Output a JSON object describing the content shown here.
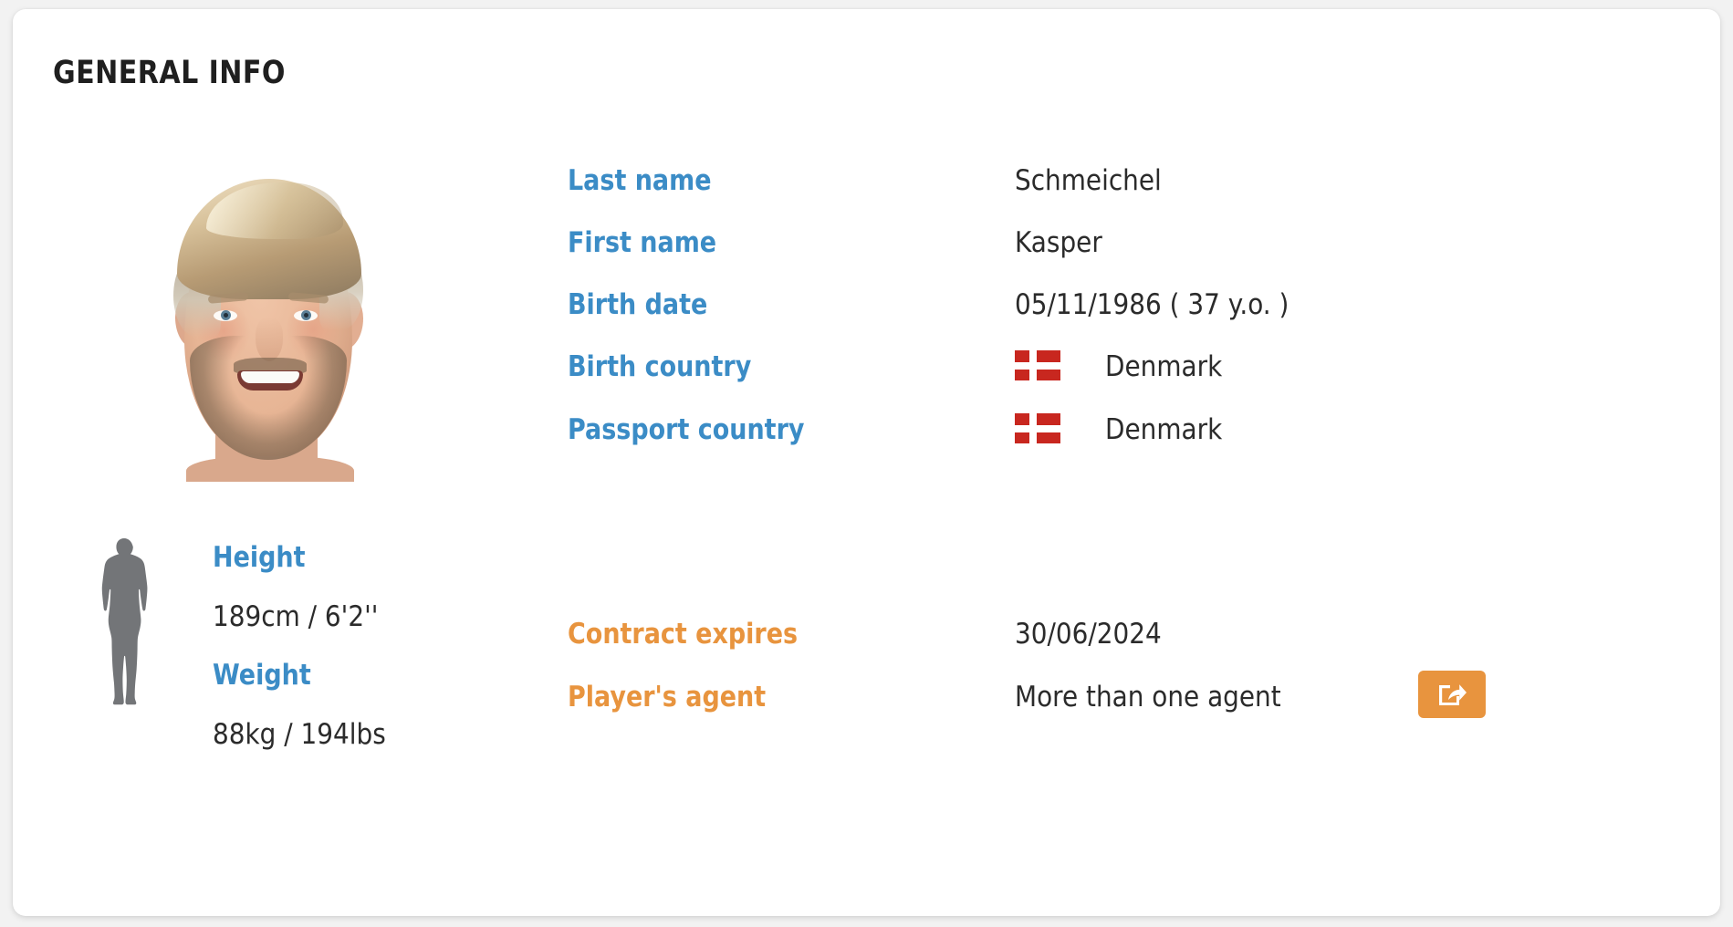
{
  "card": {
    "title": "GENERAL INFO"
  },
  "colors": {
    "label_blue": "#3b8cc6",
    "label_orange": "#e8943e",
    "value_text": "#2b2b2b",
    "title_text": "#1f1f1f",
    "card_bg": "#ffffff",
    "page_bg": "#f2f2f2",
    "flag_red": "#c8271f",
    "silhouette_gray": "#737578",
    "button_orange": "#e8943e"
  },
  "photo": {
    "icon_name": "player-headshot-photo",
    "alt": "Kasper Schmeichel headshot"
  },
  "identity": {
    "rows": [
      {
        "label": "Last name",
        "value": "Schmeichel",
        "flag": false
      },
      {
        "label": "First name",
        "value": "Kasper",
        "flag": false
      },
      {
        "label": "Birth date",
        "value": "05/11/1986 ( 37 y.o. )",
        "flag": false
      },
      {
        "label": "Birth country",
        "value": "Denmark",
        "flag": true
      },
      {
        "label": "Passport country",
        "value": "Denmark",
        "flag": true
      }
    ]
  },
  "physical": {
    "silhouette_icon": "body-silhouette-icon",
    "height_label": "Height",
    "height_value": "189cm / 6'2''",
    "weight_label": "Weight",
    "weight_value": "88kg / 194lbs"
  },
  "contract": {
    "expires_label": "Contract expires",
    "expires_value": "30/06/2024",
    "agent_label": "Player's agent",
    "agent_value": "More than one agent",
    "agent_button_icon": "external-link-share-icon"
  }
}
